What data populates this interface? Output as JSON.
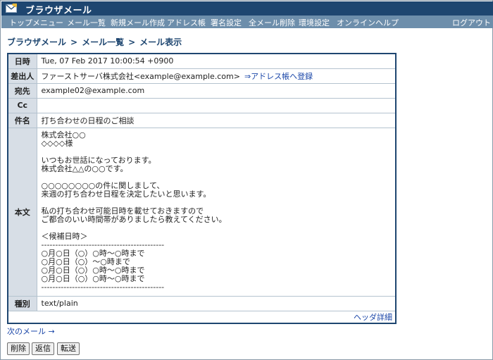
{
  "app": {
    "title": "ブラウザメール"
  },
  "nav": {
    "items": [
      "トップメニュー",
      "メール一覧",
      "新規メール作成",
      "アドレス帳",
      "署名設定",
      "全メール削除",
      "環境設定",
      "オンラインヘルプ"
    ],
    "logout": "ログアウト"
  },
  "breadcrumb": [
    "ブラウザメール",
    "メール一覧",
    "メール表示"
  ],
  "breadcrumb_sep": ">",
  "mail": {
    "date_label": "日時",
    "date": "Tue, 07 Feb 2017 10:00:54 +0900",
    "from_label": "差出人",
    "from": "ファーストサーバ株式会社<example@example.com>",
    "add_address_link": "⇒アドレス帳へ登録",
    "to_label": "宛先",
    "to": "example02@example.com",
    "cc_label": "Cc",
    "cc": "",
    "subject_label": "件名",
    "subject": "打ち合わせの日程のご相談",
    "body_label": "本文",
    "body": "株式会社○○\n◇◇◇◇様\n\nいつもお世話になっております。\n株式会社△△の○○です。\n\n○○○○○○○○の件に関しまして、\n来週の打ち合わせ日程を決定したいと思います。\n\n私の打ち合わせ可能日時を載せておきますので\nご都合のいい時間帯がありましたら教えてください。\n\n＜候補日時＞\n--------------------------------------------\n○月○日（○）○時～○時まで\n○月○日（○）～○時まで\n○月○日（○）○時～○時まで\n○月○日（○）○時～○時まで\n--------------------------------------------",
    "type_label": "種別",
    "type": "text/plain",
    "header_detail_link": "ヘッダ詳細"
  },
  "next_mail_link": "次のメール →",
  "buttons": {
    "delete": "削除",
    "reply": "返信",
    "forward": "転送"
  },
  "colors": {
    "title_bar": "#1e4670",
    "nav_bar": "#6d8eab",
    "label_cell": "#d7dee6",
    "link": "#1a46a8"
  },
  "icons": {
    "logo": "envelope-icon"
  }
}
